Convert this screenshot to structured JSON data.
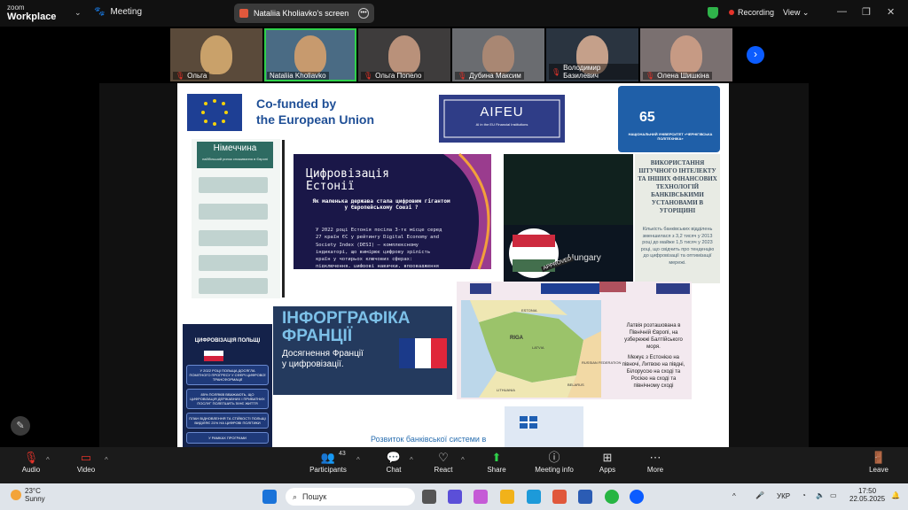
{
  "app": {
    "brand_small": "zoom",
    "brand_name": "Workplace",
    "meeting_label": "Meeting"
  },
  "share_pill": {
    "label": "Nataliia Kholiavko's screen"
  },
  "status": {
    "recording": "Recording",
    "view": "View"
  },
  "participants": [
    {
      "name": "Ольга",
      "muted": true,
      "color": "#c9a16a",
      "bg": "#5a4a3a"
    },
    {
      "name": "Nataliia Kholiavko",
      "muted": false,
      "color": "#c79a6e",
      "bg": "#4a6b84",
      "active": true
    },
    {
      "name": "Ольга Попело",
      "muted": true,
      "color": "#b9917a",
      "bg": "#3e3c3c"
    },
    {
      "name": "Дубина Максим",
      "muted": true,
      "color": "#a98773",
      "bg": "#6a6c70"
    },
    {
      "name": "Володимир Базилевич",
      "muted": true,
      "color": "#c5a08a",
      "bg": "#2a3440"
    },
    {
      "name": "Олена Шишкіна",
      "muted": true,
      "color": "#c69a84",
      "bg": "#7a7070"
    }
  ],
  "slide": {
    "cofunded": "Co-funded by\nthe European Union",
    "aifeu": "AIFEU",
    "aifeu_sub": "AI in the EU Financial Institutions",
    "univ_number": "65",
    "univ_name": "НАЦІОНАЛЬНИЙ УНІВЕРСИТЕТ «ЧЕРНІГІВСЬКА ПОЛІТЕХНІКА»",
    "germany_title": "Німеччина",
    "germany_sub": "найбільший ринок споживання в Європі",
    "estonia_title": "Цифровізація\nЕстонії",
    "estonia_q": "Як маленька держава стала цифровим гігантом у Європейському Союзі ?",
    "estonia_body": "У 2022 році Естонія посіла 3-тє місце серед 27 країн ЄС у рейтингу Digital Economy and Society Index (DESI) — комплексному індикаторі, що вимірює цифрову зрілість країн у чотирьох ключових сферах: підключення, цифрові навички, впровадження технологій у бізнесі та цифрові державні послуги.",
    "hungary_label": "Hungary",
    "hungary_stamp": "APPROVED",
    "hungary_title": "ВИКОРИСТАННЯ ШТУЧНОГО ІНТЕЛЕКТУ ТА ІНШИХ ФІНАНСОВИХ ТЕХНОЛОГІЙ БАНКІВСЬКИМИ УСТАНОВАМИ В УГОРЩИНІ",
    "hungary_body": "Кількість банківських відділень зменшилася з 3,2 тисяч у 2013 році до майже 1,5 тисяч у 2023 році, що свідчить про тенденцію до цифровізації та оптимізації мережі.",
    "poland_title": "ЦИФРОВІЗАЦІЯ ПОЛЬЩІ",
    "poland_items": [
      "У 2022 РОЦІ ПОЛЬЩА ДОСЯГЛА ПОМІТНОГО ПРОГРЕСУ У СФЕРІ ЦИФРОВОЇ ТРАНСФОРМАЦІЇ",
      "85% ПОЛЯКІВ ВВАЖАЮТЬ, ЩО ЦИФРОВІЗАЦІЯ ДЕРЖАВНИХ І ПРИВАТНИХ ПОСЛУГ ПОЛЕГШИТЬ ЇХНЄ ЖИТТЯ",
      "ПЛАН ВІДНОВЛЕННЯ ТА СТІЙКОСТІ ПОЛЬЩІ ВИДІЛЯЄ 21% НА ЦИФРОВІ ПОЛІТИКИ",
      "У РАМКАХ ПРОГРАМИ"
    ],
    "france_title": "ІНФОРГРАФІКА\nФРАНЦІЇ",
    "france_sub": "Досягнення Франції\nу цифровізації.",
    "latvia_text1": "Латвія розташована в Північній Європі, на узбережжі Балтійського моря.",
    "latvia_text2": "Межує з Естонією на півночі, Литвою на півдні, Білоруссю на сході та Росією на сході та північному сході",
    "latvia_map": [
      "ESTONIA",
      "RIGA",
      "LATVIA",
      "LITHUANIA",
      "BELARUS",
      "RUSSIAN FEDERATION"
    ],
    "greece_title": "Розвиток банківської системи в"
  },
  "controls": {
    "audio": "Audio",
    "video": "Video",
    "participants": "Participants",
    "participants_count": "43",
    "chat": "Chat",
    "react": "React",
    "share": "Share",
    "meeting_info": "Meeting info",
    "apps": "Apps",
    "more": "More",
    "leave": "Leave"
  },
  "taskbar": {
    "temp": "23°C",
    "weather": "Sunny",
    "search_placeholder": "Пошук",
    "lang": "УКР",
    "time": "17:50",
    "date": "22.05.2025"
  }
}
